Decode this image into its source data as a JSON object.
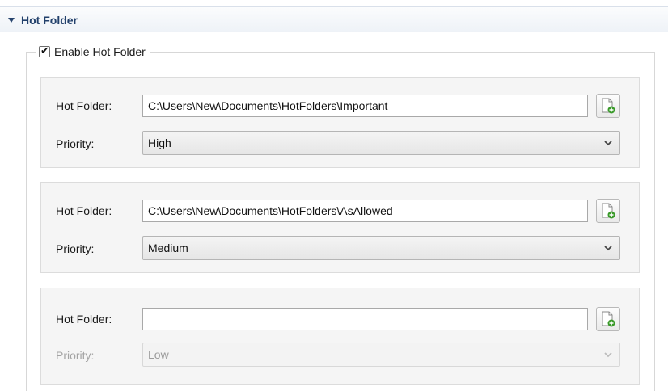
{
  "section": {
    "title": "Hot Folder",
    "collapse_icon": "triangle-down-icon"
  },
  "enable": {
    "label": "Enable Hot Folder",
    "checked": true
  },
  "entries": [
    {
      "folder_label": "Hot Folder:",
      "folder_value": "C:\\Users\\New\\Documents\\HotFolders\\Important",
      "priority_label": "Priority:",
      "priority_value": "High",
      "enabled": true
    },
    {
      "folder_label": "Hot Folder:",
      "folder_value": "C:\\Users\\New\\Documents\\HotFolders\\AsAllowed",
      "priority_label": "Priority:",
      "priority_value": "Medium",
      "enabled": true
    },
    {
      "folder_label": "Hot Folder:",
      "folder_value": "",
      "priority_label": "Priority:",
      "priority_value": "Low",
      "enabled": false
    }
  ],
  "icons": {
    "add_folder": "add-document-icon",
    "dropdown": "chevron-down-icon"
  },
  "colors": {
    "header_text": "#22406b",
    "plus_green": "#3a9a2a"
  }
}
